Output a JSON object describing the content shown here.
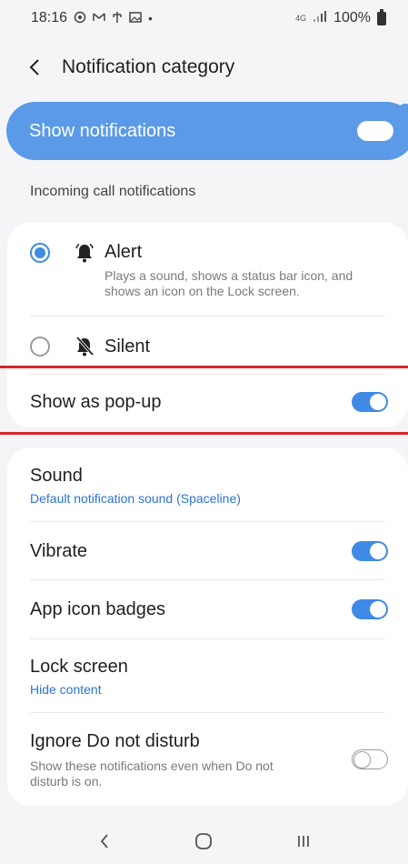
{
  "status_bar": {
    "time": "18:16",
    "network": "4G",
    "battery": "100%"
  },
  "app_bar": {
    "title": "Notification category"
  },
  "master": {
    "label": "Show notifications",
    "enabled": true
  },
  "section": {
    "header": "Incoming call notifications"
  },
  "alert_options": [
    {
      "title": "Alert",
      "description": "Plays a sound, shows a status bar icon, and shows an icon on the Lock screen.",
      "selected": true,
      "icon": "bell-ring-icon"
    },
    {
      "title": "Silent",
      "selected": false,
      "icon": "bell-off-icon"
    }
  ],
  "popup": {
    "label": "Show as pop-up",
    "enabled": true
  },
  "settings": {
    "sound": {
      "title": "Sound",
      "value": "Default notification sound (Spaceline)"
    },
    "vibrate": {
      "title": "Vibrate",
      "enabled": true
    },
    "badges": {
      "title": "App icon badges",
      "enabled": true
    },
    "lock_screen": {
      "title": "Lock screen",
      "value": "Hide content"
    },
    "dnd": {
      "title": "Ignore Do not disturb",
      "description": "Show these notifications even when Do not disturb is on.",
      "enabled": false
    }
  },
  "colors": {
    "accent": "#3e8ae6",
    "master_bg": "#5a9ae6",
    "highlight": "#d7262b"
  }
}
